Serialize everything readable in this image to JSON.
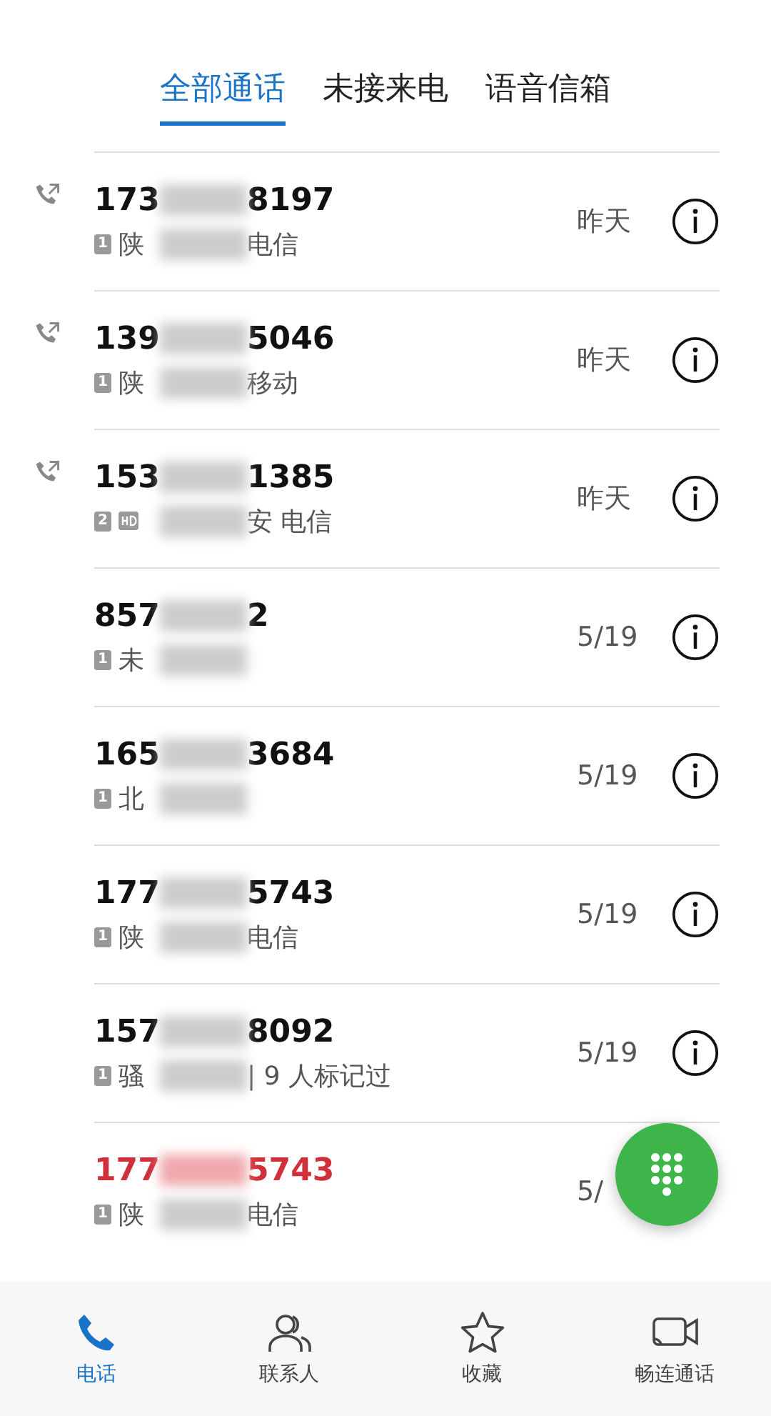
{
  "tabs": [
    {
      "label": "全部通话",
      "selected": true
    },
    {
      "label": "未接来电",
      "selected": false
    },
    {
      "label": "语音信箱",
      "selected": false
    }
  ],
  "calls": [
    {
      "outgoing": true,
      "missed": false,
      "sim": "1",
      "hd": false,
      "number_start": "173",
      "number_end": "8197",
      "location_start": "陕",
      "location_end": "电信",
      "date": "昨天",
      "info": true
    },
    {
      "outgoing": true,
      "missed": false,
      "sim": "1",
      "hd": false,
      "number_start": "139",
      "number_end": "5046",
      "location_start": "陕",
      "location_end": "移动",
      "date": "昨天",
      "info": true
    },
    {
      "outgoing": true,
      "missed": false,
      "sim": "2",
      "hd": true,
      "number_start": "153",
      "number_end": "1385",
      "location_end": "安 电信",
      "date": "昨天",
      "info": true
    },
    {
      "outgoing": false,
      "missed": false,
      "sim": "1",
      "hd": false,
      "number_start": "857",
      "number_end": "2",
      "location_start": "未",
      "date": "5/19",
      "info": true
    },
    {
      "outgoing": false,
      "missed": false,
      "sim": "1",
      "hd": false,
      "number_start": "165",
      "number_end": "3684",
      "location_start": "北",
      "date": "5/19",
      "info": true
    },
    {
      "outgoing": false,
      "missed": false,
      "sim": "1",
      "hd": false,
      "number_start": "177",
      "number_end": "5743",
      "location_start": "陕",
      "location_end": "电信",
      "date": "5/19",
      "info": true
    },
    {
      "outgoing": false,
      "missed": false,
      "sim": "1",
      "hd": false,
      "number_start": "157",
      "number_end": "8092",
      "location_start": "骚",
      "location_end": "| 9 人标记过",
      "date": "5/19",
      "info": true
    },
    {
      "outgoing": false,
      "missed": true,
      "sim": "1",
      "hd": false,
      "number_start": "177",
      "number_end": "5743",
      "location_start": "陕",
      "location_end": "电信",
      "date": "5/"
    }
  ],
  "nav": [
    {
      "kind": "phone",
      "label": "电话",
      "selected": true
    },
    {
      "kind": "contacts",
      "label": "联系人",
      "selected": false
    },
    {
      "kind": "star",
      "label": "收藏",
      "selected": false
    },
    {
      "kind": "video",
      "label": "畅连通话",
      "selected": false
    }
  ]
}
